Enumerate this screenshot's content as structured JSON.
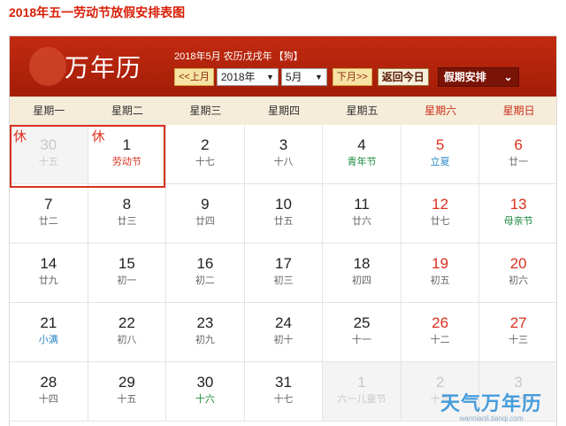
{
  "page_title": "2018年五一劳动节放假安排表图",
  "header": {
    "logo_text": "万年历",
    "date_info": "2018年5月 农历戊戌年",
    "zodiac": "【狗】",
    "prev_month": "<<上月",
    "year_select": "2018年",
    "month_select": "5月",
    "next_month": "下月>>",
    "today_button": "返回今日",
    "holiday_select": "假期安排"
  },
  "weekdays": [
    "星期一",
    "星期二",
    "星期三",
    "星期四",
    "星期五",
    "星期六",
    "星期日"
  ],
  "rest_label": "休",
  "weeks": [
    [
      {
        "num": "30",
        "lunar": "十五",
        "other": true,
        "rest": true
      },
      {
        "num": "1",
        "lunar": "劳动节",
        "fest": "red",
        "rest": true
      },
      {
        "num": "2",
        "lunar": "十七"
      },
      {
        "num": "3",
        "lunar": "十八"
      },
      {
        "num": "4",
        "lunar": "青年节",
        "fest": "green"
      },
      {
        "num": "5",
        "lunar": "立夏",
        "fest": "blue",
        "weekend": true
      },
      {
        "num": "6",
        "lunar": "廿一",
        "weekend": true
      }
    ],
    [
      {
        "num": "7",
        "lunar": "廿二"
      },
      {
        "num": "8",
        "lunar": "廿三"
      },
      {
        "num": "9",
        "lunar": "廿四"
      },
      {
        "num": "10",
        "lunar": "廿五"
      },
      {
        "num": "11",
        "lunar": "廿六"
      },
      {
        "num": "12",
        "lunar": "廿七",
        "weekend": true
      },
      {
        "num": "13",
        "lunar": "母亲节",
        "fest": "green",
        "weekend": true
      }
    ],
    [
      {
        "num": "14",
        "lunar": "廿九"
      },
      {
        "num": "15",
        "lunar": "初一"
      },
      {
        "num": "16",
        "lunar": "初二"
      },
      {
        "num": "17",
        "lunar": "初三"
      },
      {
        "num": "18",
        "lunar": "初四"
      },
      {
        "num": "19",
        "lunar": "初五",
        "weekend": true
      },
      {
        "num": "20",
        "lunar": "初六",
        "weekend": true
      }
    ],
    [
      {
        "num": "21",
        "lunar": "小满",
        "fest": "blue"
      },
      {
        "num": "22",
        "lunar": "初八"
      },
      {
        "num": "23",
        "lunar": "初九"
      },
      {
        "num": "24",
        "lunar": "初十"
      },
      {
        "num": "25",
        "lunar": "十一"
      },
      {
        "num": "26",
        "lunar": "十二",
        "weekend": true
      },
      {
        "num": "27",
        "lunar": "十三",
        "weekend": true
      }
    ],
    [
      {
        "num": "28",
        "lunar": "十四"
      },
      {
        "num": "29",
        "lunar": "十五"
      },
      {
        "num": "30",
        "lunar": "十六",
        "fest": "green"
      },
      {
        "num": "31",
        "lunar": "十七"
      },
      {
        "num": "1",
        "lunar": "六一儿童节",
        "fest": "green",
        "other": true
      },
      {
        "num": "2",
        "lunar": "十九",
        "other": true
      },
      {
        "num": "3",
        "lunar": "二十",
        "other": true
      }
    ]
  ],
  "watermark": {
    "main": "天气万年历",
    "sub": "wannianli.tianqi.com"
  }
}
